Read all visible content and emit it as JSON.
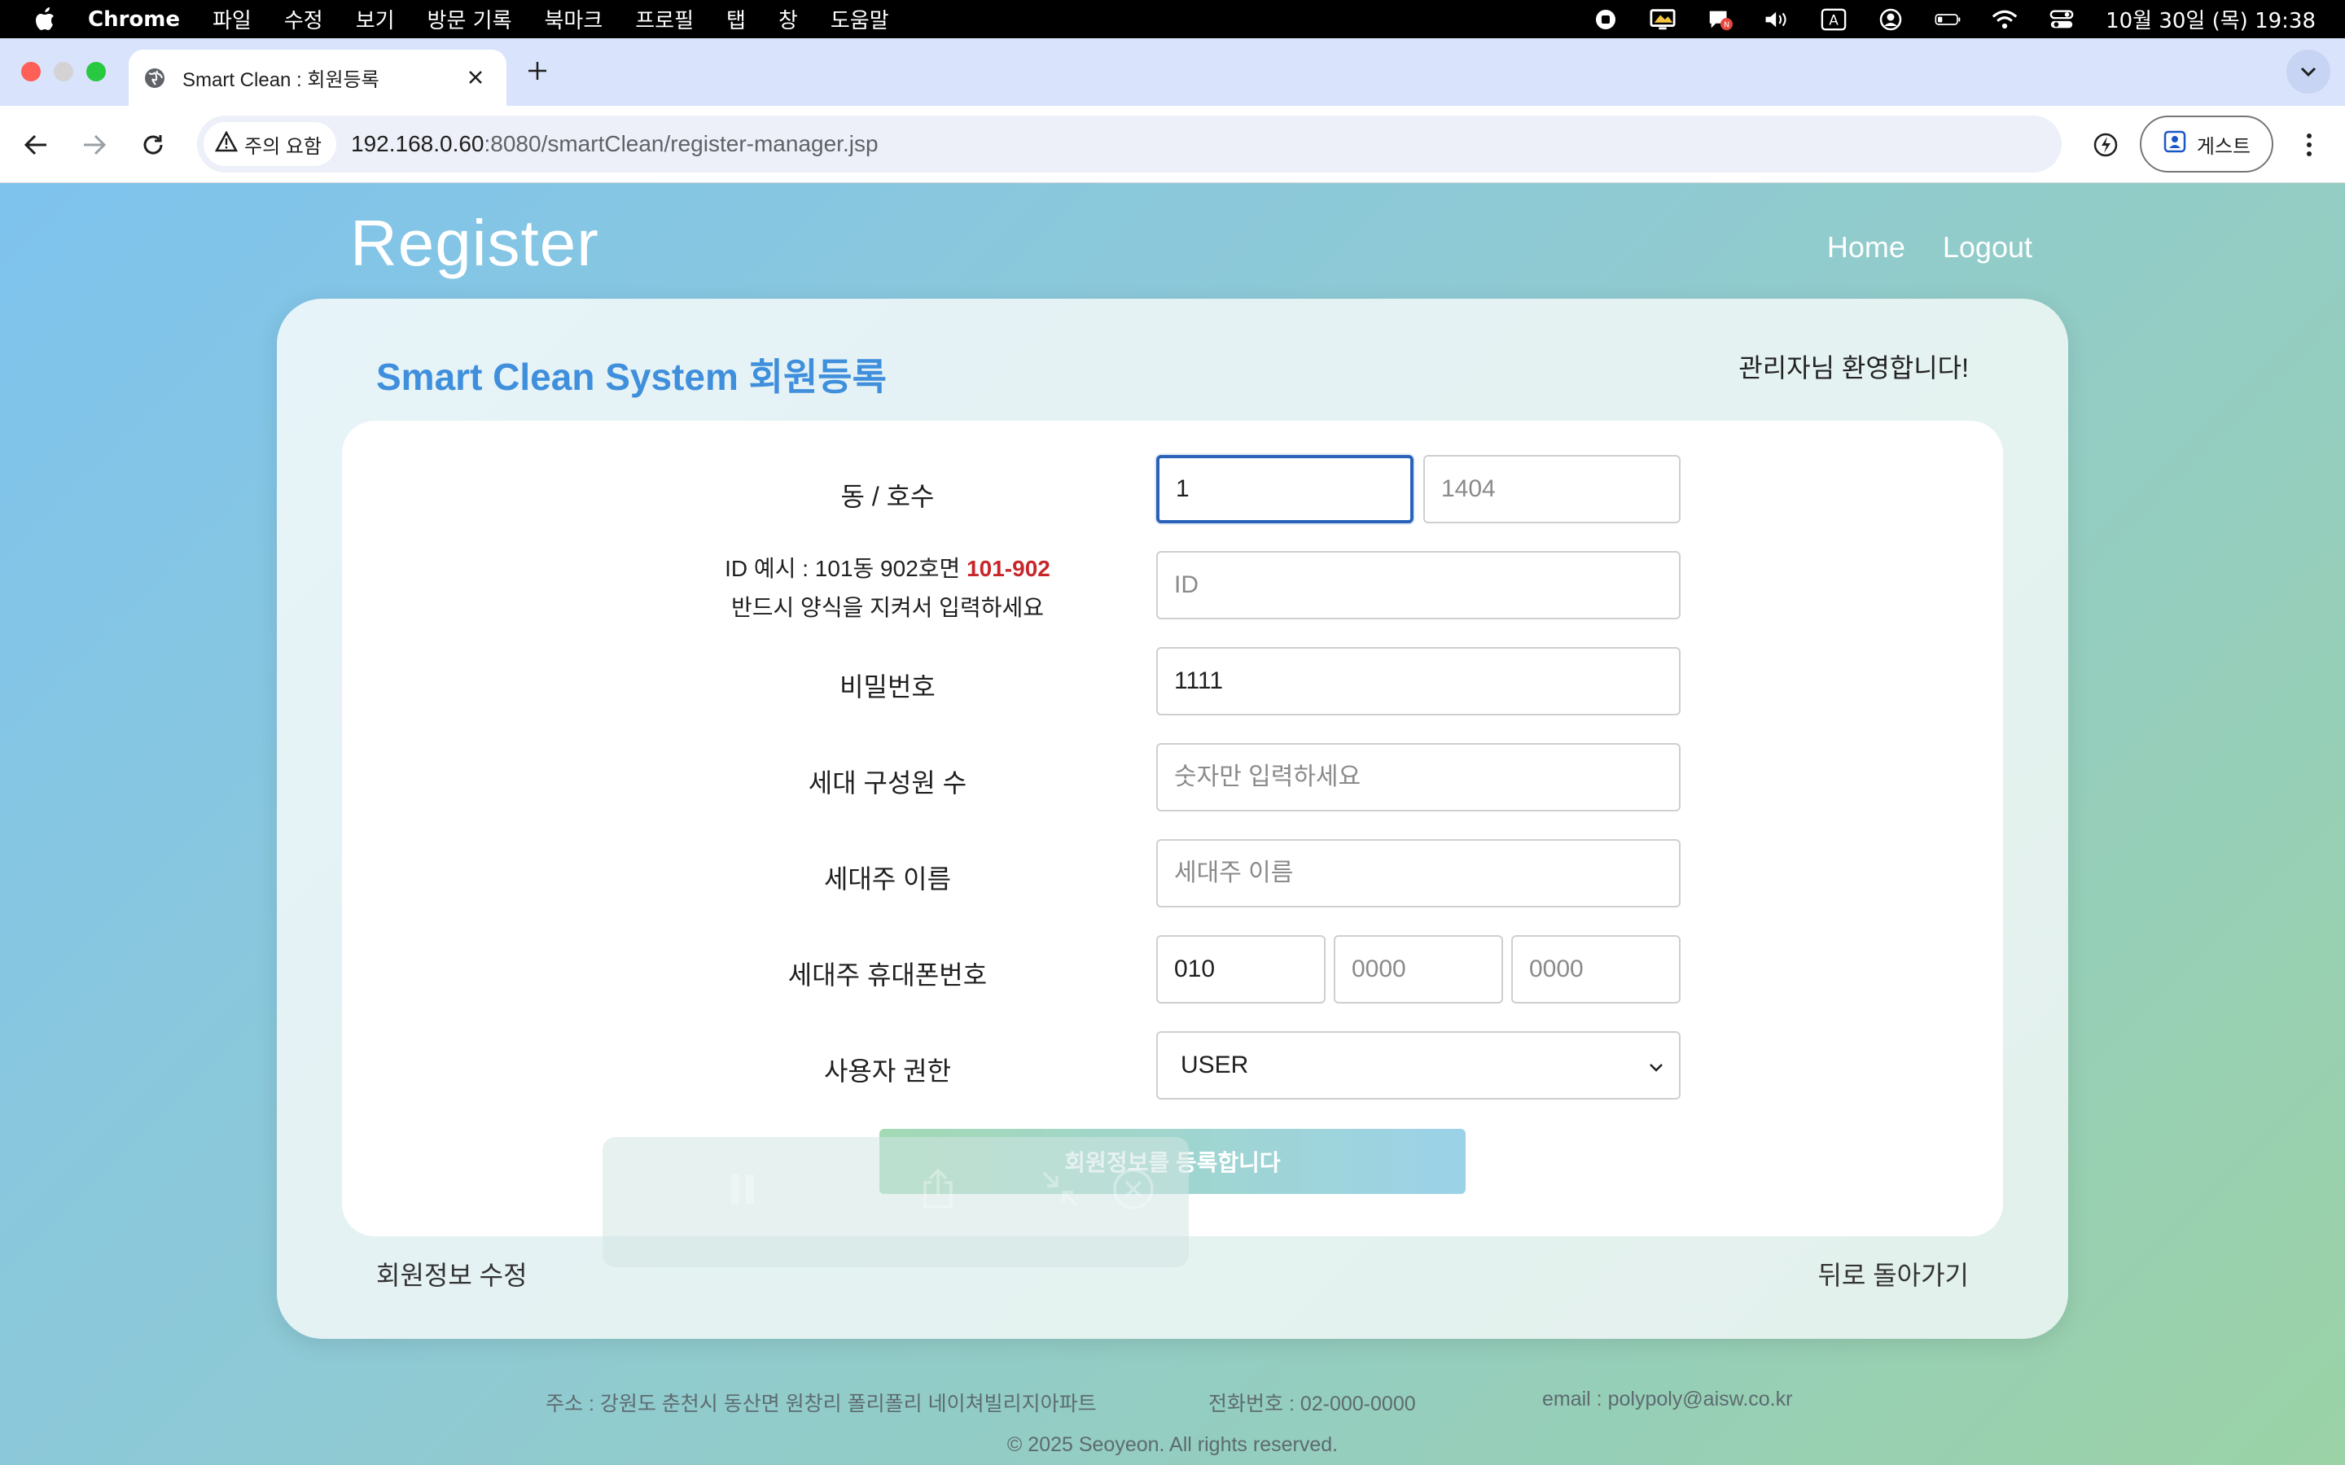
{
  "menubar": {
    "app_name": "Chrome",
    "menus": [
      "파일",
      "수정",
      "보기",
      "방문 기록",
      "북마크",
      "프로필",
      "탭",
      "창",
      "도움말"
    ],
    "clock": "10월 30일 (목) 19:38",
    "status_icons": [
      "record-icon",
      "display-icon",
      "chat-icon",
      "volume-icon",
      "input-source-icon",
      "user-icon",
      "battery-icon",
      "wifi-icon",
      "control-center-icon"
    ]
  },
  "browser": {
    "tab_title": "Smart Clean : 회원등록",
    "security_chip": "주의 요함",
    "url_host": "192.168.0.60",
    "url_rest": ":8080/smartClean/register-manager.jsp",
    "guest_label": "게스트"
  },
  "site": {
    "brand": "Register",
    "nav": {
      "home": "Home",
      "logout": "Logout"
    }
  },
  "card": {
    "title": "Smart Clean System 회원등록",
    "welcome": "관리자님 환영합니다!"
  },
  "form": {
    "dong_label": "동 / 호수",
    "dong_value": "1",
    "ho_placeholder": "1404",
    "id_hint_line1": "ID 예시 : 101동 902호면 ",
    "id_hint_red": "101-902",
    "id_hint_line2": "반드시 양식을 지켜서 입력하세요",
    "id_placeholder": "ID",
    "password_label": "비밀번호",
    "password_value": "1111",
    "members_label": "세대 구성원 수",
    "members_placeholder": "숫자만 입력하세요",
    "owner_label": "세대주 이름",
    "owner_placeholder": "세대주 이름",
    "phone_label": "세대주 휴대폰번호",
    "phone_first_value": "010",
    "phone_mid_placeholder": "0000",
    "phone_last_placeholder": "0000",
    "role_label": "사용자 권한",
    "role_value": "USER",
    "submit_label": "회원정보를 등록합니다"
  },
  "links": {
    "edit": "회원정보 수정",
    "back": "뒤로 돌아가기"
  },
  "footer": {
    "address": "주소 : 강원도 춘천시 동산면 원창리 폴리폴리 네이쳐빌리지아파트",
    "phone": "전화번호 : 02-000-0000",
    "email": "email : polypoly@aisw.co.kr",
    "copyright": "© 2025 Seoyeon. All rights reserved."
  },
  "colors": {
    "accent": "#3f8fdc",
    "hint_red": "#c8262a",
    "focus": "#2a62b9"
  }
}
